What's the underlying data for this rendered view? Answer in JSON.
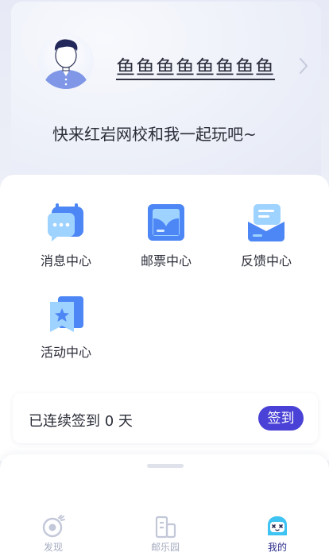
{
  "profile": {
    "username": "鱼鱼鱼鱼鱼鱼鱼鱼",
    "slogan": "快来红岩网校和我一起玩吧~"
  },
  "features": [
    {
      "label": "消息中心",
      "icon": "message-icon"
    },
    {
      "label": "邮票中心",
      "icon": "stamp-icon"
    },
    {
      "label": "反馈中心",
      "icon": "feedback-icon"
    },
    {
      "label": "活动中心",
      "icon": "activity-icon"
    }
  ],
  "signin": {
    "text": "已连续签到 0 天",
    "button_label": "签到"
  },
  "tabs": [
    {
      "label": "发现",
      "icon": "discover-icon",
      "active": false
    },
    {
      "label": "邮乐园",
      "icon": "building-icon",
      "active": false
    },
    {
      "label": "我的",
      "icon": "mine-icon",
      "active": true
    }
  ],
  "colors": {
    "accent": "#4a42d6",
    "icon_blue": "#4d86f5",
    "active_tab_text": "#2d2f8e",
    "inactive_tab_text": "#a6acc0"
  }
}
